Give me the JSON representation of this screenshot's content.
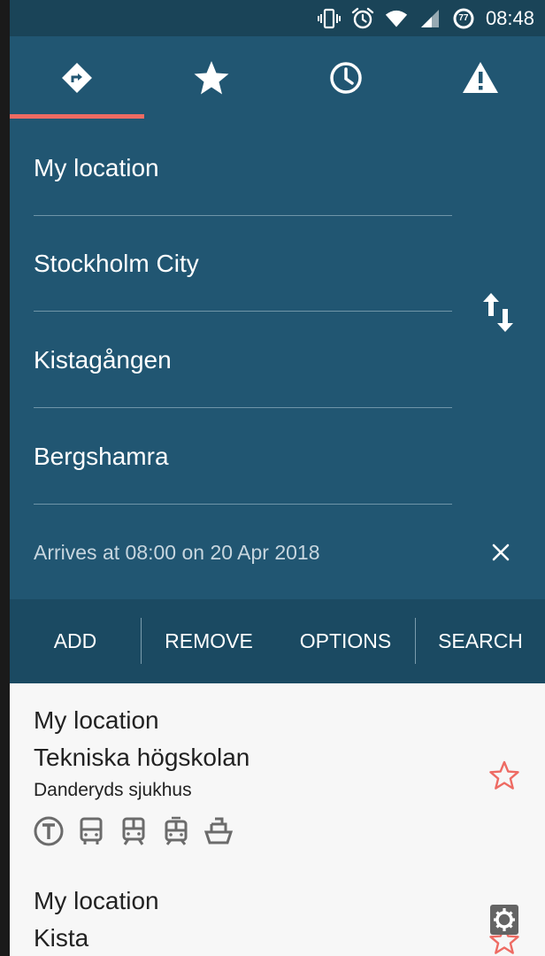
{
  "status_bar": {
    "time": "08:48",
    "battery_level": "77",
    "icons": [
      "vibrate-icon",
      "alarm-icon",
      "wifi-icon",
      "signal-icon",
      "battery-icon"
    ]
  },
  "tabs": [
    {
      "id": "directions",
      "icon": "directions-icon",
      "selected": true
    },
    {
      "id": "favorites",
      "icon": "star-icon",
      "selected": false
    },
    {
      "id": "history",
      "icon": "clock-icon",
      "selected": false
    },
    {
      "id": "alerts",
      "icon": "warning-icon",
      "selected": false
    }
  ],
  "route_fields": [
    {
      "label": "My location"
    },
    {
      "label": "Stockholm City"
    },
    {
      "label": "Kistagången"
    },
    {
      "label": "Bergshamra"
    }
  ],
  "arrives_text": "Arrives at 08:00 on 20 Apr 2018",
  "actions": {
    "add": "ADD",
    "remove": "REMOVE",
    "options": "OPTIONS",
    "search": "SEARCH"
  },
  "results": [
    {
      "from": "My location",
      "to": "Tekniska högskolan",
      "via": "Danderyds sjukhus",
      "modes": [
        "metro-icon",
        "bus-icon",
        "train-icon",
        "tram-icon",
        "ferry-icon"
      ]
    },
    {
      "from": "My location",
      "to": "Kista"
    }
  ],
  "colors": {
    "status_bar": "#1a4458",
    "header": "#215672",
    "action_bar": "#1b4a62",
    "accent": "#ee6b63",
    "list_background": "#f7f7f7"
  }
}
